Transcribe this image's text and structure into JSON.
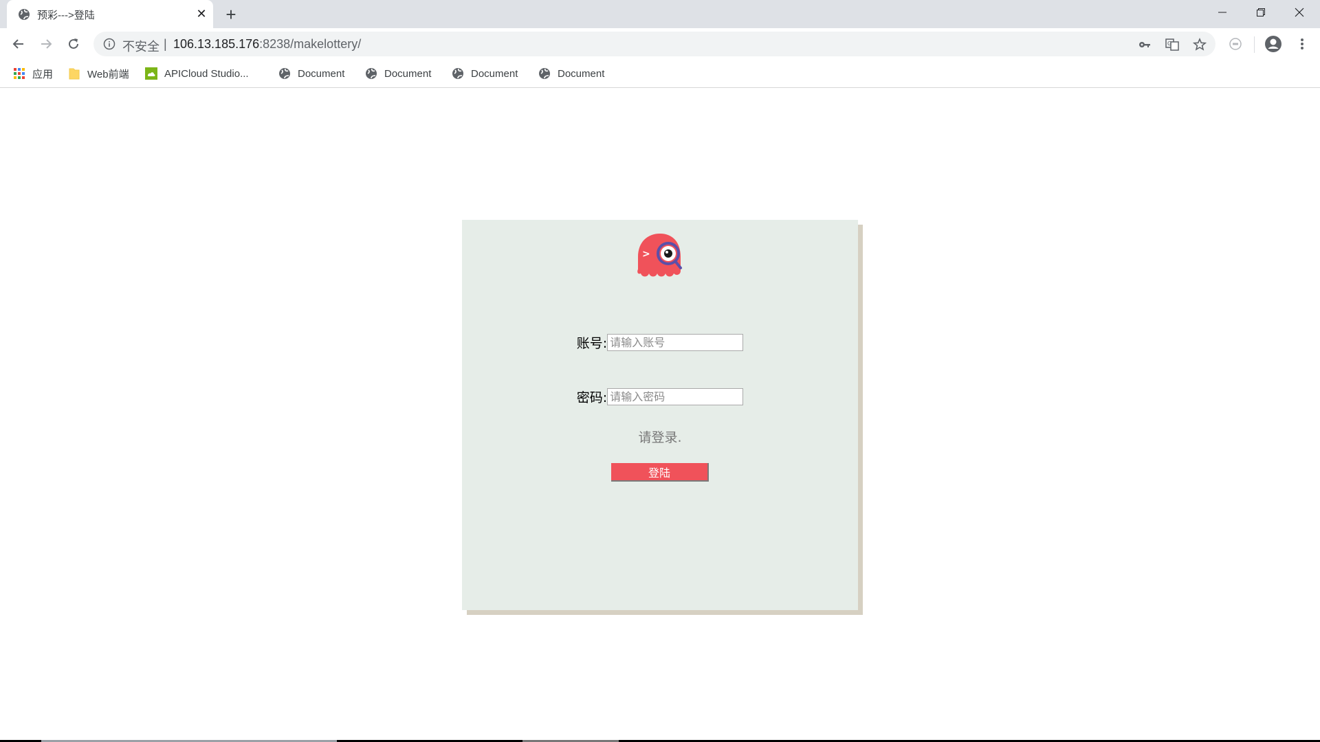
{
  "tab": {
    "title": "预彩--->登陆",
    "close_glyph": "✕",
    "new_tab_glyph": "+"
  },
  "omnibox": {
    "security_label": "不安全",
    "separator": "|",
    "url_host": "106.13.185.176",
    "url_rest": ":8238/makelottery/"
  },
  "bookmarks": [
    {
      "label": "应用",
      "icon": "apps-grid-icon"
    },
    {
      "label": "Web前端",
      "icon": "folder-icon"
    },
    {
      "label": "APICloud Studio...",
      "icon": "apicloud-icon"
    },
    {
      "label": "Document",
      "icon": "globe-icon"
    },
    {
      "label": "Document",
      "icon": "globe-icon"
    },
    {
      "label": "Document",
      "icon": "globe-icon"
    },
    {
      "label": "Document",
      "icon": "globe-icon"
    }
  ],
  "login": {
    "account_label": "账号:",
    "account_placeholder": "请输入账号",
    "password_label": "密码:",
    "password_placeholder": "请输入密码",
    "hint": "请登录.",
    "submit_label": "登陆"
  },
  "colors": {
    "card_bg": "#e6ede8",
    "card_shadow": "#d6d0c2",
    "brand_red": "#f0525a",
    "logo_ring": "#5b4fa8"
  }
}
